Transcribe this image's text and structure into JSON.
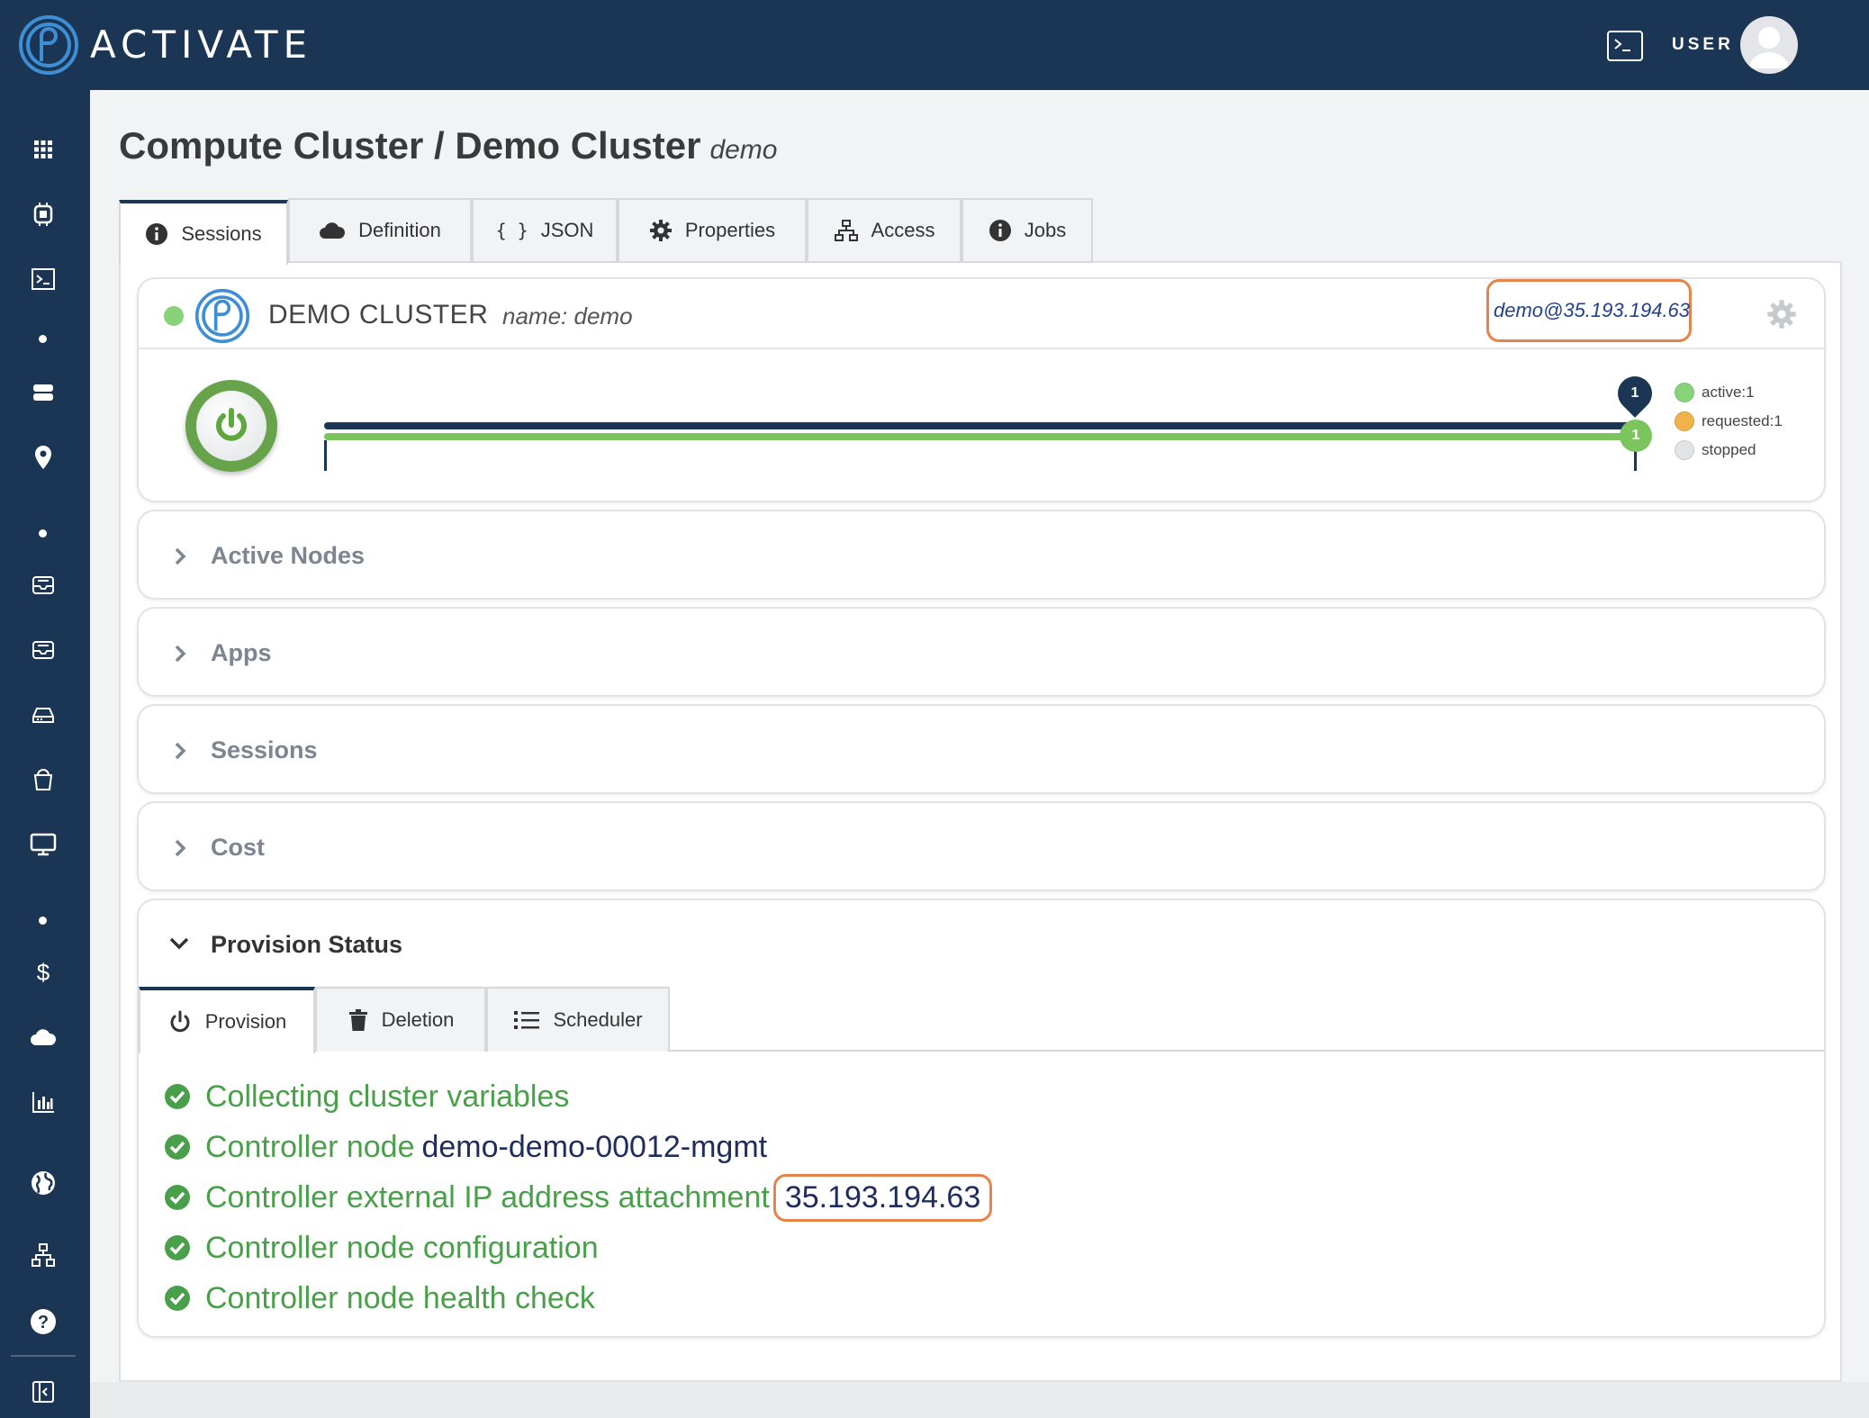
{
  "brand": {
    "name": "ACTIVATE"
  },
  "header": {
    "user_label": "USER",
    "terminal_icon": "terminal-icon",
    "avatar_icon": "user-avatar-icon"
  },
  "sidebar": {
    "icons": [
      "grid-icon",
      "cpu-chip-icon",
      "terminal-icon",
      "dot",
      "server-icon",
      "map-pin-icon",
      "dot",
      "inbox-icon",
      "inbox-icon",
      "hard-drive-icon",
      "bucket-icon",
      "monitor-icon",
      "dot",
      "dollar-icon",
      "cloud-icon",
      "bar-chart-icon",
      "globe-icon",
      "sitemap-icon",
      "help-icon",
      "collapse-icon"
    ]
  },
  "page": {
    "title": "Compute Cluster / Demo Cluster",
    "subtitle": "demo"
  },
  "tabs": [
    {
      "label": "Sessions",
      "icon": "info-icon",
      "active": true
    },
    {
      "label": "Definition",
      "icon": "cloud-icon"
    },
    {
      "label": "JSON",
      "icon": "braces-icon"
    },
    {
      "label": "Properties",
      "icon": "gear-icon"
    },
    {
      "label": "Access",
      "icon": "network-icon"
    },
    {
      "label": "Jobs",
      "icon": "info-icon"
    }
  ],
  "cluster": {
    "name": "DEMO CLUSTER",
    "name_detail": "name: demo",
    "ssh": "demo@35.193.194.63",
    "status_color": "#88d27a",
    "marker_top": "1",
    "marker_bottom": "1",
    "legend": [
      {
        "label": "active:1",
        "color": "#88d27a"
      },
      {
        "label": "requested:1",
        "color": "#f0b24a"
      },
      {
        "label": "stopped",
        "color": "#d4d6d9"
      }
    ]
  },
  "accordions": {
    "active_nodes": "Active Nodes",
    "apps": "Apps",
    "sessions": "Sessions",
    "cost": "Cost",
    "provision_status": "Provision Status"
  },
  "provision_tabs": [
    {
      "label": "Provision",
      "icon": "power-icon",
      "active": true
    },
    {
      "label": "Deletion",
      "icon": "trash-icon"
    },
    {
      "label": "Scheduler",
      "icon": "list-icon"
    }
  ],
  "steps": [
    {
      "text": "Collecting cluster variables",
      "value": ""
    },
    {
      "text": "Controller node",
      "value": "demo-demo-00012-mgmt"
    },
    {
      "text": "Controller external IP address attachment",
      "value": "35.193.194.63"
    },
    {
      "text": "Controller node configuration",
      "value": ""
    },
    {
      "text": "Controller node health check",
      "value": ""
    }
  ],
  "colors": {
    "navy": "#1b3654",
    "green": "#7cc45e",
    "highlight": "#e7824a",
    "link": "#22428f"
  }
}
